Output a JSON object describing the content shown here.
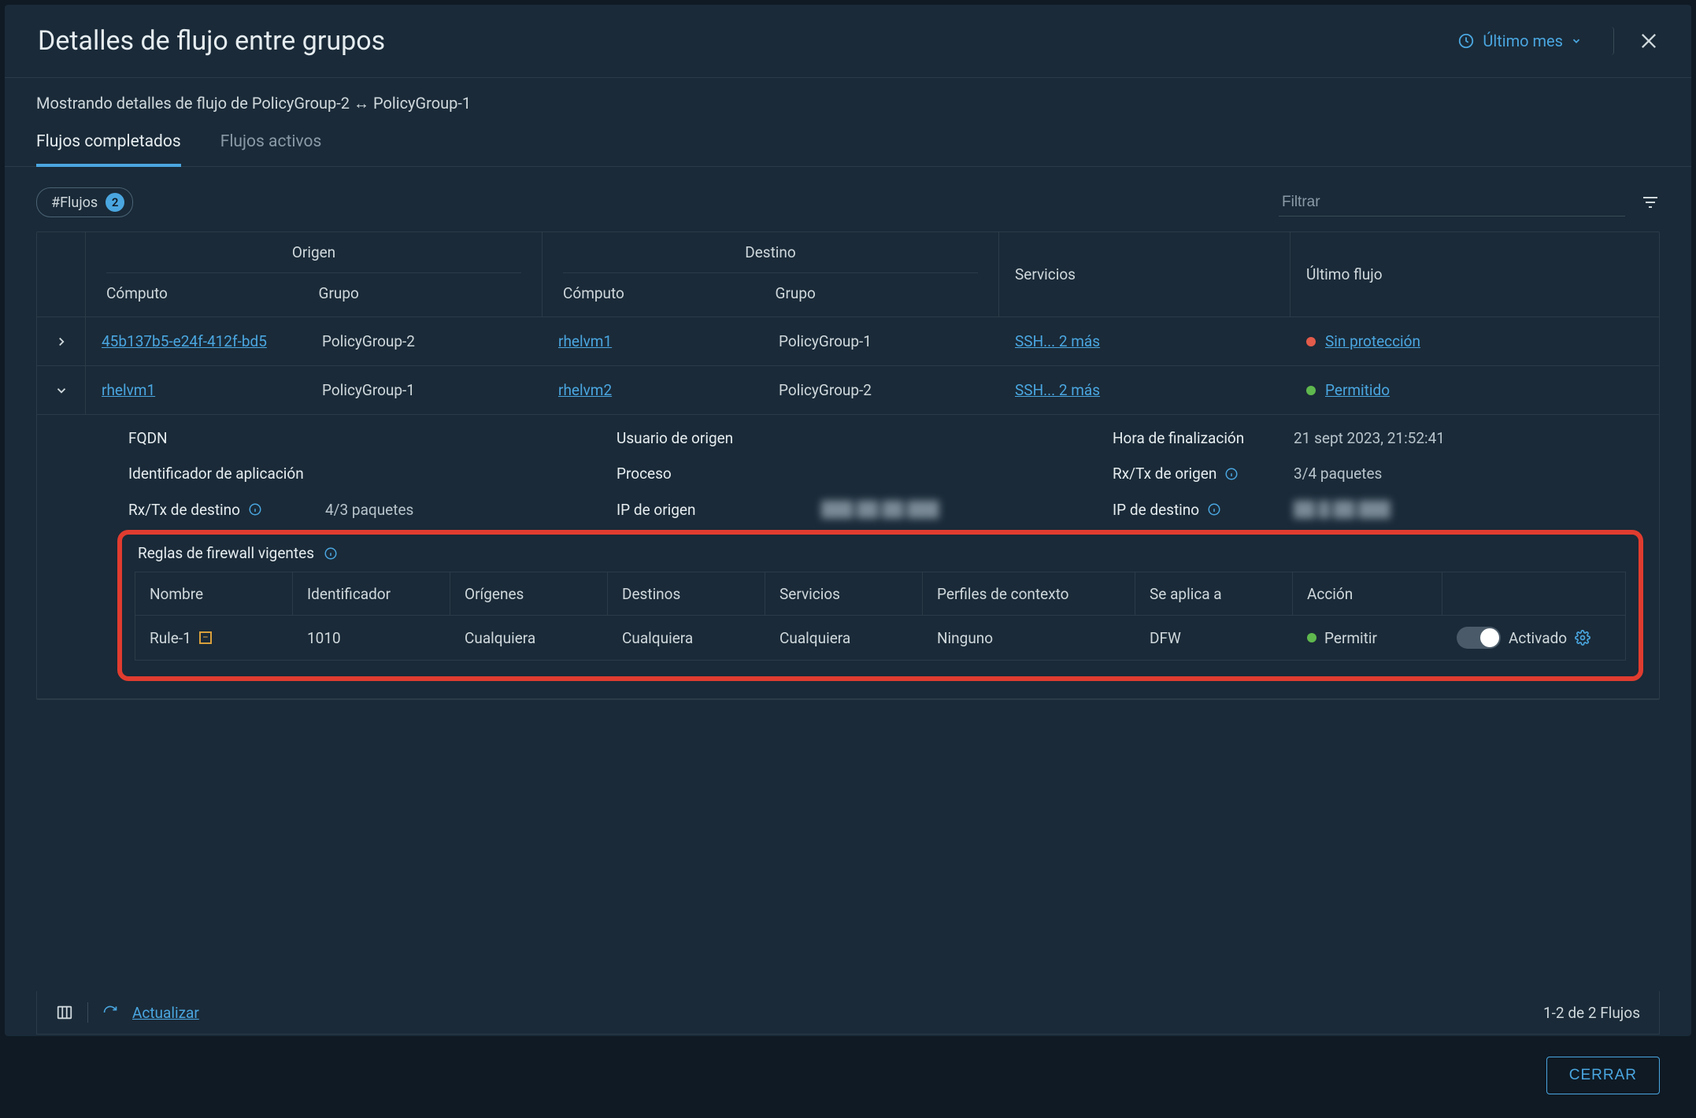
{
  "header": {
    "title": "Detalles de flujo entre grupos",
    "time_filter": "Último mes",
    "close_label": "CERRAR"
  },
  "subheader": "Mostrando detalles de flujo de PolicyGroup-2 ↔ PolicyGroup-1",
  "tabs": {
    "completed": "Flujos completados",
    "active": "Flujos activos"
  },
  "filter": {
    "flows_label": "#Flujos",
    "flows_count": "2",
    "placeholder": "Filtrar"
  },
  "columns": {
    "source": "Origen",
    "dest": "Destino",
    "compute": "Cómputo",
    "group": "Grupo",
    "services": "Servicios",
    "last_flow": "Último flujo"
  },
  "rows": [
    {
      "src_compute": "45b137b5-e24f-412f-bd5",
      "src_group": "PolicyGroup-2",
      "dst_compute": "rhelvm1",
      "dst_group": "PolicyGroup-1",
      "services": "SSH... 2 más",
      "status_text": "Sin protección",
      "status_color": "red"
    },
    {
      "src_compute": "rhelvm1",
      "src_group": "PolicyGroup-1",
      "dst_compute": "rhelvm2",
      "dst_group": "PolicyGroup-2",
      "services": "SSH... 2 más",
      "status_text": "Permitido",
      "status_color": "green"
    }
  ],
  "detail": {
    "fqdn_label": "FQDN",
    "src_user_label": "Usuario de origen",
    "end_time_label": "Hora de finalización",
    "end_time_val": "21 sept 2023, 21:52:41",
    "app_id_label": "Identificador de aplicación",
    "process_label": "Proceso",
    "src_rxtx_label": "Rx/Tx de origen",
    "src_rxtx_val": "3/4 paquetes",
    "dst_rxtx_label": "Rx/Tx de destino",
    "dst_rxtx_val": "4/3 paquetes",
    "src_ip_label": "IP de origen",
    "src_ip_val": "███.██.██.███",
    "dst_ip_label": "IP de destino",
    "dst_ip_val": "██.█.██.███"
  },
  "firewall": {
    "title": "Reglas de firewall vigentes",
    "cols": {
      "name": "Nombre",
      "id": "Identificador",
      "sources": "Orígenes",
      "dests": "Destinos",
      "services": "Servicios",
      "context": "Perfiles de contexto",
      "applies": "Se aplica a",
      "action": "Acción"
    },
    "rule": {
      "name": "Rule-1",
      "id": "1010",
      "sources": "Cualquiera",
      "dests": "Cualquiera",
      "services": "Cualquiera",
      "context": "Ninguno",
      "applies": "DFW",
      "action": "Permitir",
      "toggle_label": "Activado"
    }
  },
  "footer": {
    "refresh": "Actualizar",
    "count": "1-2 de 2 Flujos"
  }
}
